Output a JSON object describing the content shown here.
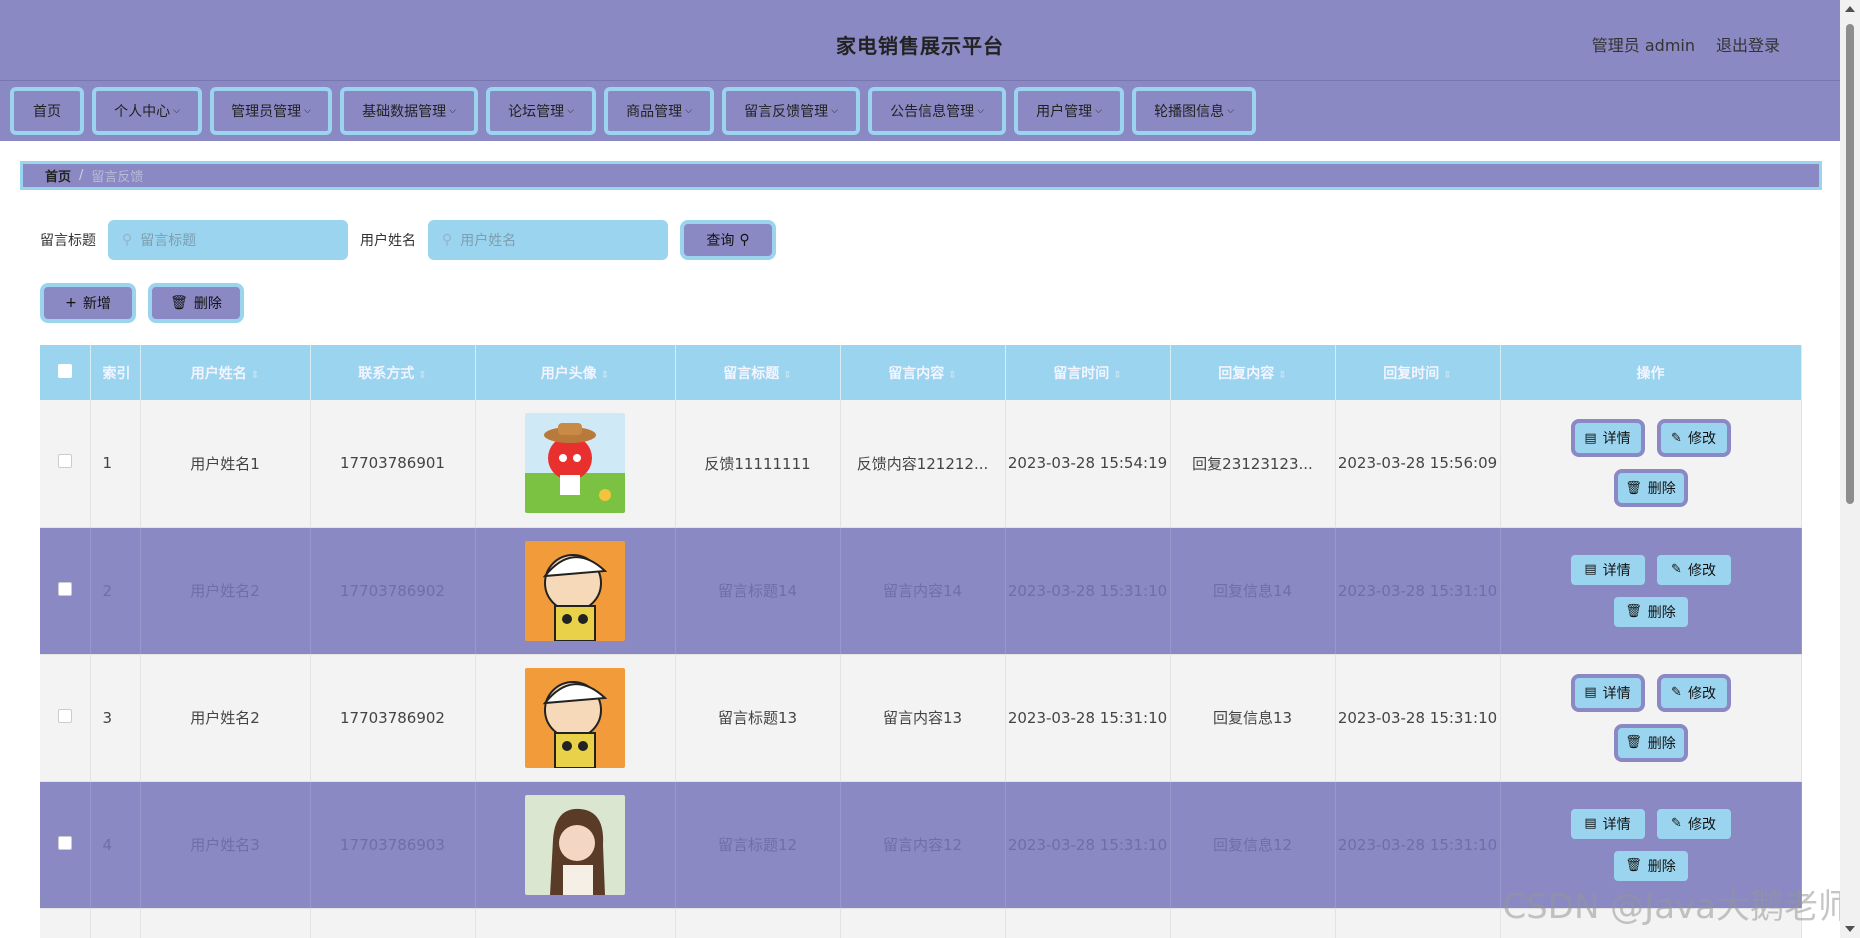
{
  "header": {
    "title": "家电销售展示平台",
    "admin": "管理员 admin",
    "logout": "退出登录"
  },
  "nav": [
    {
      "label": "首页",
      "dropdown": false
    },
    {
      "label": "个人中心",
      "dropdown": true
    },
    {
      "label": "管理员管理",
      "dropdown": true
    },
    {
      "label": "基础数据管理",
      "dropdown": true
    },
    {
      "label": "论坛管理",
      "dropdown": true
    },
    {
      "label": "商品管理",
      "dropdown": true
    },
    {
      "label": "留言反馈管理",
      "dropdown": true
    },
    {
      "label": "公告信息管理",
      "dropdown": true
    },
    {
      "label": "用户管理",
      "dropdown": true
    },
    {
      "label": "轮播图信息",
      "dropdown": true
    }
  ],
  "breadcrumb": {
    "home": "首页",
    "separator": "/",
    "current": "留言反馈"
  },
  "search": {
    "title_label": "留言标题",
    "title_placeholder": "留言标题",
    "user_label": "用户姓名",
    "user_placeholder": "用户姓名",
    "query_button": "查询"
  },
  "actions": {
    "add": "新增",
    "delete": "删除"
  },
  "table": {
    "columns": [
      "索引",
      "用户姓名",
      "联系方式",
      "用户头像",
      "留言标题",
      "留言内容",
      "留言时间",
      "回复内容",
      "回复时间",
      "操作"
    ],
    "rows": [
      {
        "index": "1",
        "username": "用户姓名1",
        "phone": "17703786901",
        "avatar": "red-fox",
        "title": "反馈11111111",
        "content": "反馈内容121212...",
        "time": "2023-03-28 15:54:19",
        "reply": "回复23123123...",
        "reply_time": "2023-03-28 15:56:09",
        "style": "light"
      },
      {
        "index": "2",
        "username": "用户姓名2",
        "phone": "17703786902",
        "avatar": "cartoon-boy",
        "title": "留言标题14",
        "content": "留言内容14",
        "time": "2023-03-28 15:31:10",
        "reply": "回复信息14",
        "reply_time": "2023-03-28 15:31:10",
        "style": "dark"
      },
      {
        "index": "3",
        "username": "用户姓名2",
        "phone": "17703786902",
        "avatar": "cartoon-boy",
        "title": "留言标题13",
        "content": "留言内容13",
        "time": "2023-03-28 15:31:10",
        "reply": "回复信息13",
        "reply_time": "2023-03-28 15:31:10",
        "style": "light"
      },
      {
        "index": "4",
        "username": "用户姓名3",
        "phone": "17703786903",
        "avatar": "girl-photo",
        "title": "留言标题12",
        "content": "留言内容12",
        "time": "2023-03-28 15:31:10",
        "reply": "回复信息12",
        "reply_time": "2023-03-28 15:31:10",
        "style": "dark"
      }
    ],
    "op_labels": {
      "detail": "详情",
      "edit": "修改",
      "delete": "删除"
    }
  },
  "watermark": "CSDN @Java大鹅老师",
  "colors": {
    "primary": "#8a89c3",
    "accent": "#9bd4ee",
    "row_light": "#f3f3f3"
  }
}
